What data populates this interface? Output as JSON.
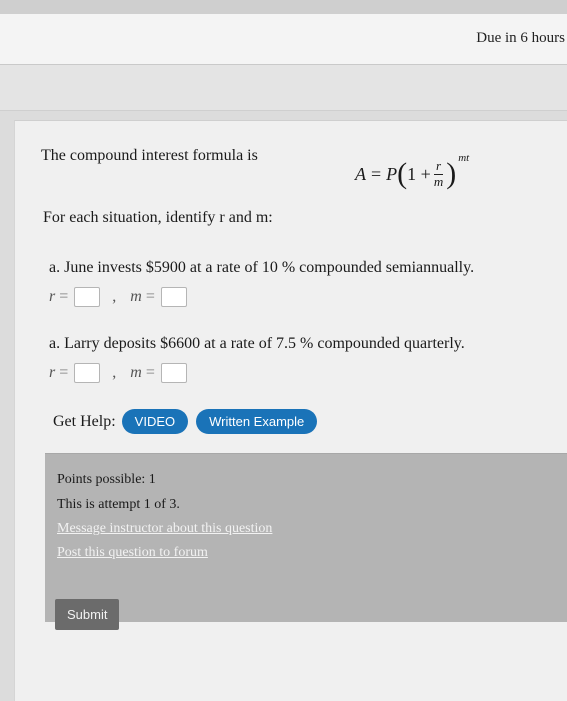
{
  "header": {
    "due_text": "Due in 6 hours"
  },
  "problem": {
    "intro": "The compound interest formula is",
    "formula": {
      "lhs": "A",
      "equals": "=",
      "P": "P",
      "one_plus": "1 +",
      "num": "r",
      "den": "m",
      "exp": "mt"
    },
    "identify_text": "For each situation, identify r and m:"
  },
  "questions": [
    {
      "text": "a. June invests $5900 at a rate of 10 % compounded semiannually.",
      "r_label": "r",
      "m_label": "m",
      "eq": "=",
      "comma": ","
    },
    {
      "text": "a. Larry deposits $6600 at a rate of 7.5 % compounded quarterly.",
      "r_label": "r",
      "m_label": "m",
      "eq": "=",
      "comma": ","
    }
  ],
  "help": {
    "label": "Get Help:",
    "video": "VIDEO",
    "written": "Written Example"
  },
  "info": {
    "points": "Points possible: 1",
    "attempt": "This is attempt 1 of 3.",
    "message_link": "Message instructor about this question",
    "forum_link": "Post this question to forum"
  },
  "submit_label": "Submit",
  "colors": {
    "pill_blue": "#1a73b8",
    "info_bg": "#b4b4b4",
    "submit_bg": "#6b6b6b"
  }
}
